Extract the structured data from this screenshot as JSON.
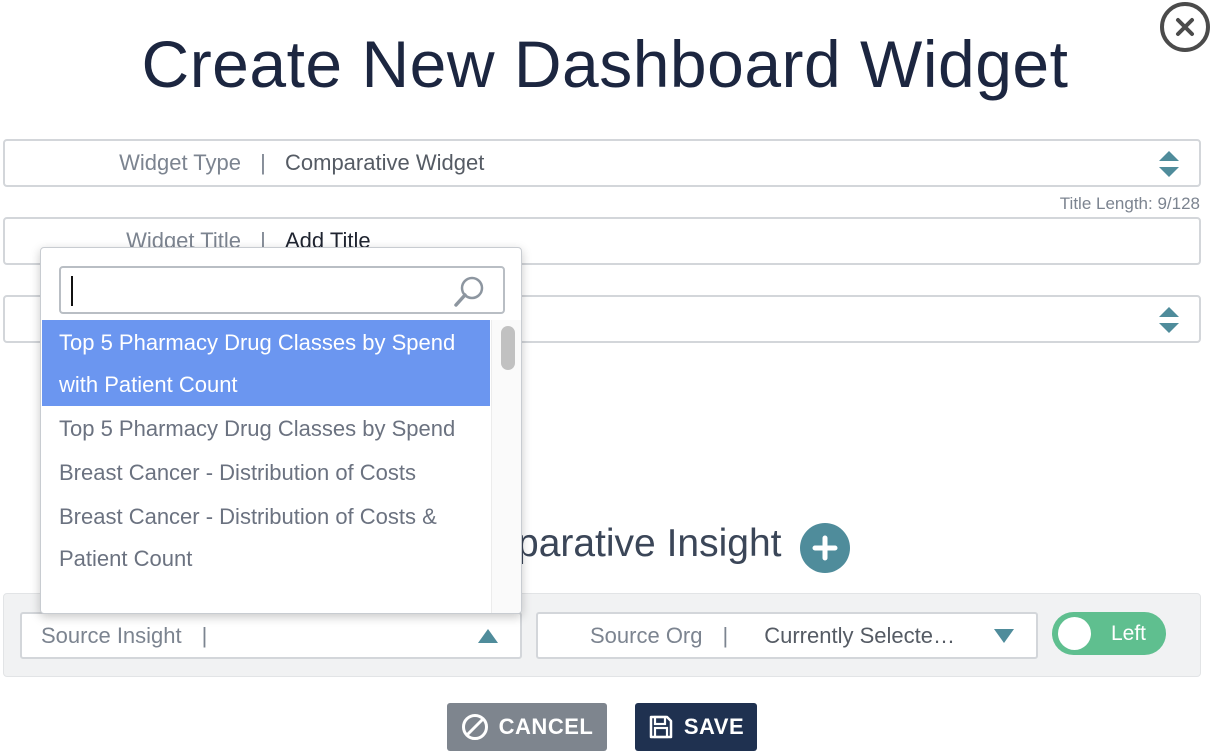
{
  "header": {
    "title": "Create New Dashboard Widget"
  },
  "form": {
    "widget_type": {
      "label": "Widget Type",
      "separator": "|",
      "value": "Comparative Widget"
    },
    "title_length": "Title Length: 9/128",
    "widget_title": {
      "label": "Widget Title",
      "separator": "|",
      "value": "Add Title"
    }
  },
  "comparative": {
    "heading_partial": "parative Insight"
  },
  "dropdown": {
    "search_value": "",
    "items": [
      {
        "label": "Top 5 Pharmacy Drug Classes by Spend with Patient Count",
        "selected": true
      },
      {
        "label": "Top 5 Pharmacy Drug Classes by Spend",
        "selected": false
      },
      {
        "label": "Breast Cancer - Distribution of Costs",
        "selected": false
      },
      {
        "label": "Breast Cancer - Distribution of Costs & Patient Count",
        "selected": false
      }
    ]
  },
  "source_insight": {
    "label": "Source Insight",
    "separator": "|",
    "value": ""
  },
  "source_org": {
    "label": "Source Org",
    "separator": "|",
    "value": "Currently Selecte…"
  },
  "toggle": {
    "label": "Left",
    "on": true
  },
  "buttons": {
    "cancel": "CANCEL",
    "save": "SAVE"
  },
  "colors": {
    "accent_teal": "#4f8c9b",
    "selected_blue": "#6b96f0",
    "save_navy": "#1f3150",
    "cancel_gray": "#7e858e",
    "toggle_green": "#5fbf8f"
  },
  "icons": {
    "close": "close-icon",
    "spinner": "up-down-arrows-icon",
    "search": "search-icon",
    "plus": "plus-icon",
    "cancel": "ban-icon",
    "save": "floppy-disk-icon"
  }
}
